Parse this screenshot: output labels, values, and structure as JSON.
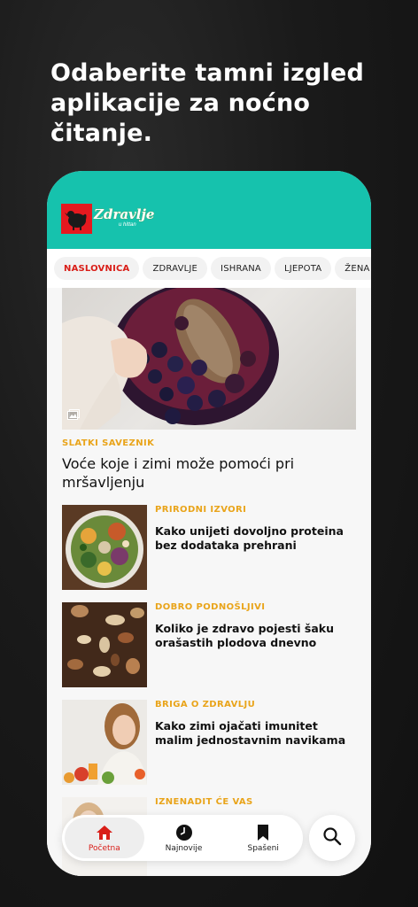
{
  "promo": {
    "headline": "Odaberite tamni izgled aplikacije za noćno čitanje."
  },
  "app": {
    "logo_text": "Zdravlje",
    "logo_sub": "u hittan",
    "brand_color": "#e5191f",
    "header_color": "#16c2ad",
    "accent_color": "#e9a41a"
  },
  "tabs": [
    {
      "label": "NASLOVNICA",
      "active": true
    },
    {
      "label": "ZDRAVLJE"
    },
    {
      "label": "ISHRANA"
    },
    {
      "label": "LJEPOTA"
    },
    {
      "label": "ŽENA"
    }
  ],
  "hero": {
    "category": "SLATKI SAVEZNIK",
    "title": "Voće koje i zimi može pomoći pri mršavljenju",
    "image_icon": "gallery-icon"
  },
  "articles": [
    {
      "category": "PRIRODNI IZVORI",
      "title": "Kako unijeti dovoljno proteina bez dodataka prehrani"
    },
    {
      "category": "DOBRO PODNOŠLJIVI",
      "title": "Koliko je zdravo pojesti šaku orašastih plodova dnevno"
    },
    {
      "category": "BRIGA O ZDRAVLJU",
      "title": "Kako zimi ojačati imunitet malim jednostavnim navikama"
    },
    {
      "category": "IZNENADIT ĆE VAS",
      "title": ""
    }
  ],
  "nav": {
    "home": "Početna",
    "latest": "Najnovije",
    "saved": "Spašeni",
    "search_icon": "search-icon"
  }
}
